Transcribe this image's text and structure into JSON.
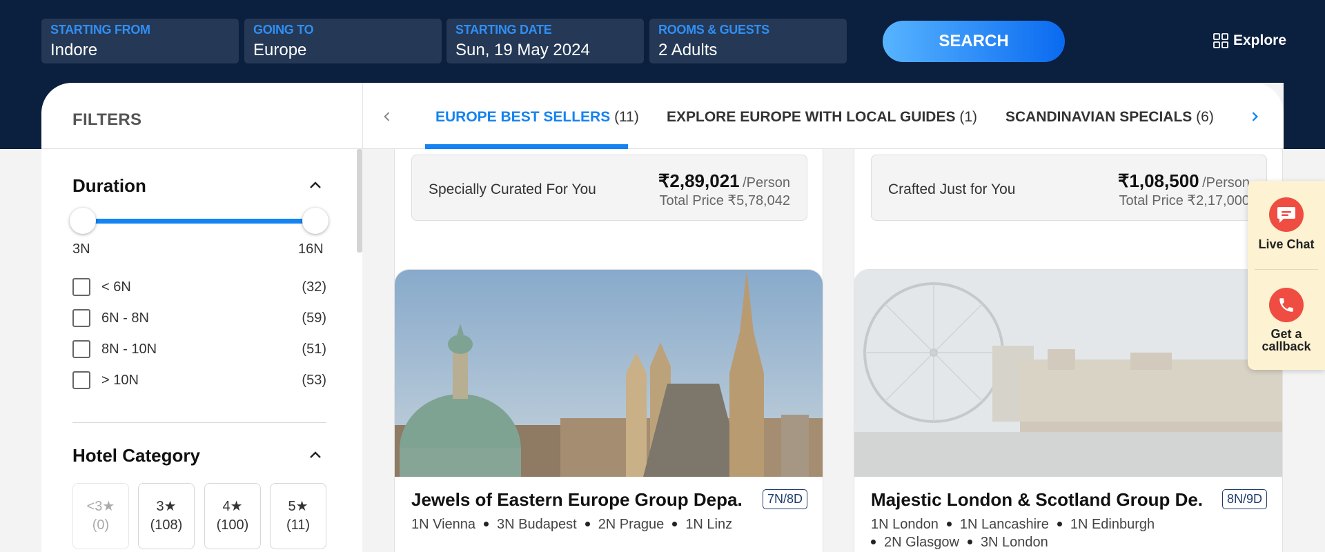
{
  "search": {
    "from": {
      "label": "STARTING FROM",
      "value": "Indore"
    },
    "to": {
      "label": "GOING TO",
      "value": "Europe"
    },
    "date": {
      "label": "STARTING DATE",
      "value": "Sun, 19 May 2024"
    },
    "guests": {
      "label": "ROOMS & GUESTS",
      "value": "2 Adults"
    },
    "button": "SEARCH"
  },
  "explore": {
    "label": "Explore",
    "icon": "grid-icon"
  },
  "filters": {
    "title": "FILTERS",
    "duration": {
      "title": "Duration",
      "range_min": "3N",
      "range_max": "16N",
      "options": [
        {
          "label": "< 6N",
          "count": "(32)"
        },
        {
          "label": "6N - 8N",
          "count": "(59)"
        },
        {
          "label": "8N - 10N",
          "count": "(51)"
        },
        {
          "label": "> 10N",
          "count": "(53)"
        }
      ]
    },
    "hotel_category": {
      "title": "Hotel Category",
      "options": [
        {
          "label": "<3★",
          "count": "(0)"
        },
        {
          "label": "3★",
          "count": "(108)"
        },
        {
          "label": "4★",
          "count": "(100)"
        },
        {
          "label": "5★",
          "count": "(11)"
        }
      ]
    }
  },
  "tabs": [
    {
      "label": "EUROPE BEST SELLERS",
      "count": "(11)"
    },
    {
      "label": "EXPLORE EUROPE WITH LOCAL GUIDES",
      "count": "(1)"
    },
    {
      "label": "SCANDINAVIAN SPECIALS",
      "count": "(6)"
    }
  ],
  "top_cards": [
    {
      "curated": "Specially Curated For You",
      "price": "₹2,89,021",
      "per": "/Person",
      "total": "Total Price ₹5,78,042"
    },
    {
      "curated": "Crafted Just for You",
      "price": "₹1,08,500",
      "per": "/Person",
      "total": "Total Price ₹2,17,000"
    }
  ],
  "cards": [
    {
      "title": "Jewels of Eastern Europe Group Depa...",
      "badge": "7N/8D",
      "cities": [
        "1N Vienna",
        "3N Budapest",
        "2N Prague",
        "1N Linz"
      ]
    },
    {
      "title": "Majestic London & Scotland Group De...",
      "badge": "8N/9D",
      "cities": [
        "1N London",
        "1N Lancashire",
        "1N Edinburgh",
        "2N Glasgow",
        "3N London"
      ]
    }
  ],
  "side_widget": {
    "live_chat": "Live Chat",
    "callback": "Get a callback"
  },
  "colors": {
    "header_bg": "#0b1f3e",
    "accent": "#1483f3",
    "widget_bg": "#fdf2d2",
    "widget_icon": "#ef4d41"
  }
}
